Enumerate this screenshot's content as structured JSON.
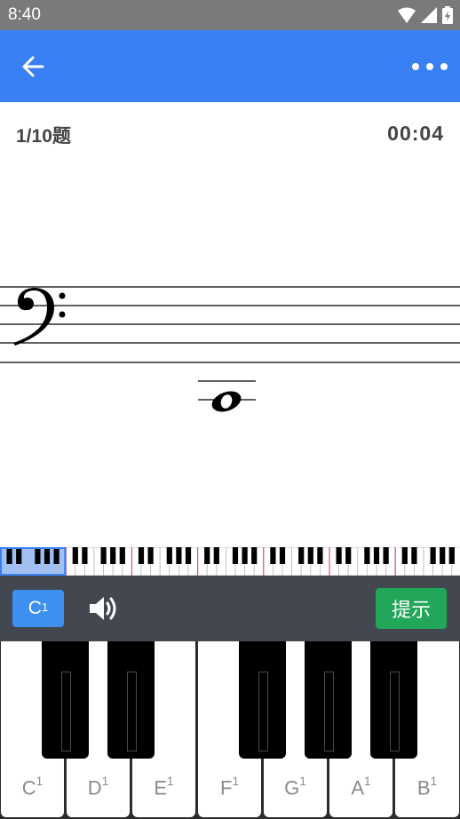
{
  "status_bar": {
    "time": "8:40"
  },
  "quiz": {
    "progress": "1/10题",
    "timer": "00:04"
  },
  "colors": {
    "app_bar": "#3a80f5",
    "note_button": "#3d8ff0",
    "hint_button": "#22a65a",
    "controls_bg": "#434750"
  },
  "icons": {
    "back": "arrow-left-icon",
    "more": "more-dots-icon",
    "speaker": "speaker-icon"
  },
  "controls": {
    "note_name": "C",
    "note_octave": "1",
    "hint_label": "提示"
  },
  "keyboard": {
    "white_keys": [
      {
        "name": "C",
        "octave": "1"
      },
      {
        "name": "D",
        "octave": "1"
      },
      {
        "name": "E",
        "octave": "1"
      },
      {
        "name": "F",
        "octave": "1"
      },
      {
        "name": "G",
        "octave": "1"
      },
      {
        "name": "A",
        "octave": "1"
      },
      {
        "name": "B",
        "octave": "1"
      }
    ]
  }
}
